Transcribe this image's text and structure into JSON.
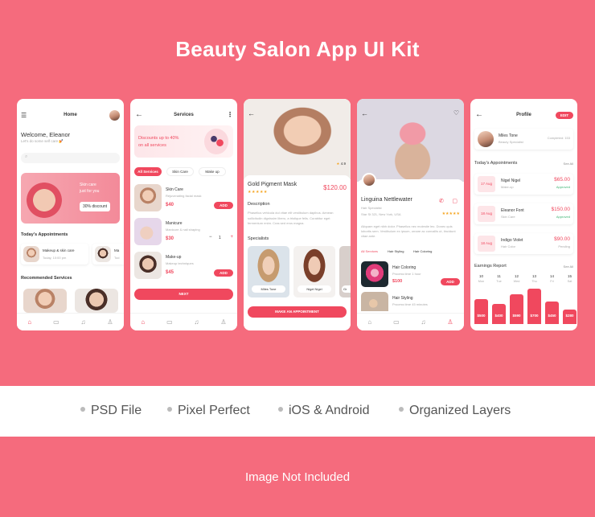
{
  "title": "Beauty Salon App UI Kit",
  "features": [
    "PSD File",
    "Pixel Perfect",
    "iOS & Android",
    "Organized Layers"
  ],
  "footer_note": "Image Not Included",
  "colors": {
    "background": "#F56B7D",
    "accent": "#F0485E",
    "feature_bar": "#FFFFFF"
  },
  "home": {
    "title": "Home",
    "welcome": "Welcome, Eleanor",
    "subtitle": "Let's do some self care 💅",
    "banner_text1": "Skin care",
    "banner_text2": "just for you",
    "banner_discount": "30% discount",
    "appointments_heading": "Today's Appointments",
    "appt1_title": "Makeup & skin care",
    "appt1_time": "Today, 10:00 pm",
    "appt2_title": "Ma",
    "appt2_time": "Tod",
    "recommended_heading": "Recommended Services"
  },
  "services": {
    "title": "Services",
    "promo_line1": "Discounts up to 40%",
    "promo_line2": "on all services",
    "filters": [
      "All Services",
      "Skin Care",
      "Make up"
    ],
    "items": [
      {
        "name": "Skin Care",
        "desc": "Rejuvenating facial mask",
        "price": "$40",
        "action": "ADD"
      },
      {
        "name": "Manicure",
        "desc": "Manicure & nail shaping",
        "price": "$30",
        "qty": "1"
      },
      {
        "name": "Make-up",
        "desc": "Makeup techniques",
        "price": "$45",
        "action": "ADD"
      }
    ],
    "next": "NEXT"
  },
  "detail": {
    "rating": "4.9",
    "name": "Gold Pigment Mask",
    "price": "$120.00",
    "description_heading": "Description",
    "description": "Phasellus vehicula dui vitae elit vestibulum dapibus. Aenean sollicitudin dignissim libero, a tristique felis. Curabitur eget fermentum enim. Cras sed eros magna.",
    "specialists_heading": "Specialists",
    "specialists": [
      "Miles Tone",
      "Nigel Nigel",
      "Gr"
    ],
    "cta": "MAKE AN APPOINTMENT"
  },
  "profile": {
    "name": "Linguina Nettlewater",
    "role": "Hair Specialist",
    "address": "Star St 321, New York, USA",
    "bio": "Aliquam eget nibh dolor. Phasellus nec molestie leo. Donec quis lobortis sem. Vestibulum ex ipsum, ornare ac convallis ut, tincidunt vitae ante.",
    "tabs": [
      "All Services",
      "Hair Styling",
      "Hair Coloring"
    ],
    "services": [
      {
        "name": "Hair Coloring",
        "desc": "Process time 1 hour",
        "price": "$100",
        "action": "ADD"
      },
      {
        "name": "Hair Styling",
        "desc": "Process time 45 minutes"
      }
    ]
  },
  "specialist": {
    "title": "Profile",
    "edit": "EDIT",
    "name": "Miles Tone",
    "role": "Beauty Specialist",
    "completed": "Completed: 153",
    "appointments_heading": "Today's Appointments",
    "see_all": "See All",
    "appointments": [
      {
        "day": "17",
        "month": "Aug",
        "name": "Nigel Nigel",
        "service": "Make-up",
        "price": "$65.00",
        "status": "Approved"
      },
      {
        "day": "18",
        "month": "Aug",
        "name": "Eleanor Font",
        "service": "Skin Care",
        "price": "$150.00",
        "status": "Approved"
      },
      {
        "day": "18",
        "month": "Aug",
        "name": "Indigo Violet",
        "service": "Hair Color",
        "price": "$90.00",
        "status": "Pending"
      }
    ],
    "earnings_heading": "Earnings Report",
    "earnings_see_all": "See All"
  },
  "chart_data": {
    "type": "bar",
    "title": "Earnings Report",
    "categories": [
      "10 Mon",
      "11 Tue",
      "12 Wed",
      "13 Thu",
      "14 Fri",
      "15 Sat"
    ],
    "values": [
      500,
      400,
      590,
      700,
      450,
      280
    ],
    "data_labels": [
      "$500",
      "$400",
      "$590",
      "$700",
      "$450",
      "$280"
    ],
    "ylim": [
      0,
      700
    ]
  }
}
